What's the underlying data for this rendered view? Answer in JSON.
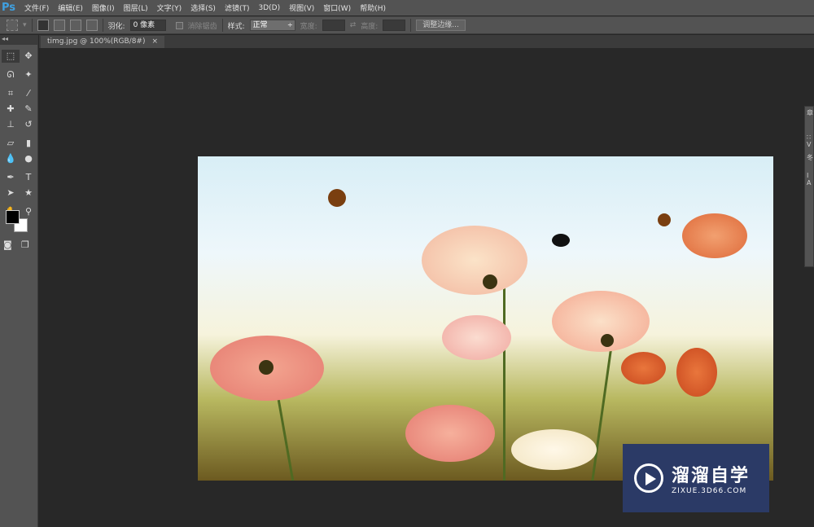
{
  "app": {
    "logo": "Ps"
  },
  "menu": [
    "文件(F)",
    "编辑(E)",
    "图像(I)",
    "图层(L)",
    "文字(Y)",
    "选择(S)",
    "滤镜(T)",
    "3D(D)",
    "视图(V)",
    "窗口(W)",
    "帮助(H)"
  ],
  "options": {
    "feather_label": "羽化:",
    "feather_value": "0 像素",
    "antialias_label": "消除锯齿",
    "style_label": "样式:",
    "style_value": "正常",
    "width_label": "宽度:",
    "height_label": "高度:",
    "refine_edge": "调整边缘..."
  },
  "document_tab": {
    "title": "timg.jpg @ 100%(RGB/8#)",
    "close": "×"
  },
  "toolbar": {
    "collapse": "◂◂",
    "tools": [
      {
        "name": "rect-marquee",
        "glyph": "⬚"
      },
      {
        "name": "move",
        "glyph": "✥"
      },
      {
        "name": "lasso",
        "glyph": "ᘏ"
      },
      {
        "name": "magic-wand",
        "glyph": "✦"
      },
      {
        "name": "crop",
        "glyph": "⌗"
      },
      {
        "name": "eyedropper",
        "glyph": "⁄"
      },
      {
        "name": "healing",
        "glyph": "✚"
      },
      {
        "name": "brush",
        "glyph": "✎"
      },
      {
        "name": "stamp",
        "glyph": "⊥"
      },
      {
        "name": "history-brush",
        "glyph": "↺"
      },
      {
        "name": "eraser",
        "glyph": "▱"
      },
      {
        "name": "gradient",
        "glyph": "▮"
      },
      {
        "name": "blur",
        "glyph": "💧"
      },
      {
        "name": "dodge",
        "glyph": "●"
      },
      {
        "name": "pen",
        "glyph": "✒"
      },
      {
        "name": "type",
        "glyph": "T"
      },
      {
        "name": "path-select",
        "glyph": "➤"
      },
      {
        "name": "shape",
        "glyph": "★"
      },
      {
        "name": "hand",
        "glyph": "✋"
      },
      {
        "name": "zoom",
        "glyph": "⚲"
      }
    ]
  },
  "colors": {
    "foreground": "#000000",
    "background": "#ffffff"
  },
  "right_panel": [
    "章",
    "∷",
    "V",
    "冬",
    "I",
    "A"
  ],
  "watermark": {
    "title": "溜溜自学",
    "url": "ZIXUE.3D66.COM"
  }
}
